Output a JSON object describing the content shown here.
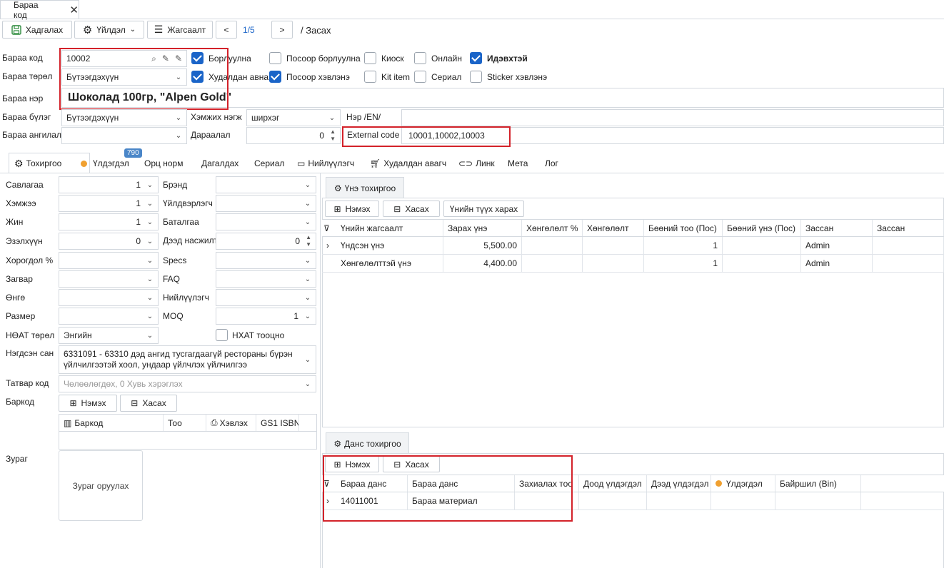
{
  "tab": {
    "title": "Бараа код"
  },
  "toolbar": {
    "save": "Хадгалах",
    "action": "Үйлдэл",
    "list": "Жагсаалт",
    "pager": "1/5",
    "mode": "/ Засах"
  },
  "form": {
    "code_label": "Бараа код",
    "code_value": "10002",
    "type_label": "Бараа төрөл",
    "type_value": "Бүтээгдэхүүн",
    "name_label": "Бараа нэр",
    "name_value": "Шоколад 100гр, \"Alpen Gold\"",
    "group_label": "Бараа бүлэг",
    "group_value": "Бүтээгдэхүүн",
    "unit_label": "Хэмжих нэгж",
    "unit_value": "ширхэг",
    "name_en_label": "Нэр /EN/",
    "category_label": "Бараа ангилал",
    "order_label": "Дараалал",
    "order_value": "0",
    "extcode_label": "External code",
    "extcode_value": "10001,10002,10003"
  },
  "checkboxes": {
    "sellable": "Борлуулна",
    "pos_sell": "Посоор борлуулна",
    "kiosk": "Киоск",
    "online": "Онлайн",
    "active": "Идэвхтэй",
    "buyable": "Худалдан авна",
    "pos_use": "Посоор хэвлэнэ",
    "kit": "Kit item",
    "serial": "Сериал",
    "sticker": "Sticker хэвлэнэ"
  },
  "subtabs": {
    "settings": "Тохиргоо",
    "stock": "Үлдэгдэл",
    "stock_badge": "790",
    "bom": "Орц норм",
    "assoc": "Дагалдах",
    "serial": "Сериал",
    "supplier": "Нийлүүлэгч",
    "buyer": "Худалдан авагч",
    "link": "Линк",
    "meta": "Мета",
    "log": "Лог"
  },
  "left": {
    "packing_label": "Савлагаа",
    "packing_value": "1",
    "volume_label": "Хэмжээ",
    "volume_value": "1",
    "weight_label": "Жин",
    "weight_value": "1",
    "capacity_label": "Эзэлхүүн",
    "capacity_value": "0",
    "discount_label": "Хорогдол %",
    "model_label": "Загвар",
    "color_label": "Өнгө",
    "size_label": "Размер",
    "vat_label": "НӨАТ төрөл",
    "vat_value": "Энгийн",
    "brand_label": "Брэнд",
    "maker_label": "Үйлдвэрлэгч",
    "warranty_label": "Баталгаа",
    "maxdisc_label": "Дээд насжилт",
    "maxdisc_value": "0",
    "specs_label": "Specs",
    "faq_label": "FAQ",
    "supplier_label": "Нийлүүлэгч",
    "moq_label": "MOQ",
    "moq_value": "1",
    "city_tax_label": "НХАТ тооцно",
    "classifier_label": "Нэгдсэн сан",
    "classifier_value": "6331091 - 63310 дэд ангид тусгагдаагүй рестораны бүрэн үйлчилгээтэй хоол, ундаар үйлчлэх үйлчилгээ",
    "taxcode_label": "Татвар код",
    "taxcode_placeholder": "Чөлөөлөгдөх, 0 Хувь хэрэглэх",
    "barcode_label": "Баркод",
    "add": "Нэмэх",
    "remove": "Хасах",
    "barcode_cols": [
      "Баркод",
      "Тоо",
      "Хэвлэх",
      "GS1 ISBN"
    ],
    "image_label": "Зураг",
    "image_upload": "Зураг оруулах"
  },
  "price": {
    "tab": "Үнэ тохиргоо",
    "add": "Нэмэх",
    "remove": "Хасах",
    "history": "Үнийн түүх харах",
    "columns": [
      "Үнийн жагсаалт",
      "Зарах үнэ",
      "Хөнгөлөлт %",
      "Хөнгөлөлт",
      "Бөөний тоо (Пос)",
      "Бөөний үнэ (Пос)",
      "Зассан",
      "Зассан"
    ],
    "rows": [
      [
        "Үндсэн үнэ",
        "5,500.00",
        "",
        "",
        "1",
        "",
        "Admin",
        ""
      ],
      [
        "Хөнгөлөлттэй үнэ",
        "4,400.00",
        "",
        "",
        "1",
        "",
        "Admin",
        ""
      ]
    ]
  },
  "account": {
    "tab": "Данс тохиргоо",
    "add": "Нэмэх",
    "remove": "Хасах",
    "columns": [
      "Бараа данс",
      "Бараа данс",
      "Захиалах тоо",
      "Доод үлдэгдэл",
      "Дээд үлдэгдэл",
      "Үлдэгдэл",
      "Байршил (Bin)"
    ],
    "rows": [
      [
        "14011001",
        "Бараа материал",
        "",
        "",
        "",
        "",
        ""
      ]
    ]
  }
}
